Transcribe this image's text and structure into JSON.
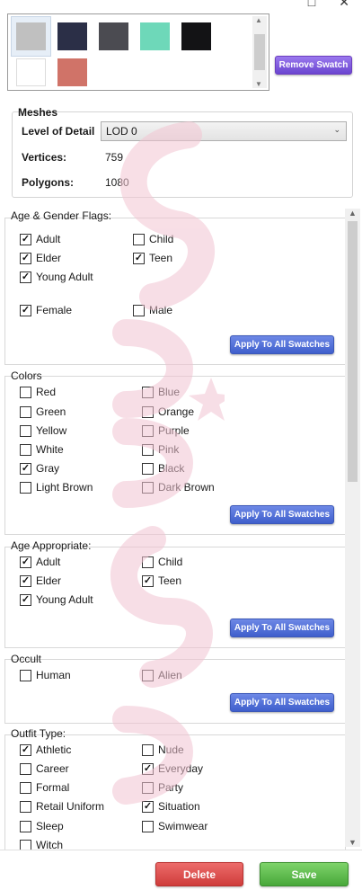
{
  "colors": {
    "swatches": [
      "#c0c0c0",
      "#2b2f47",
      "#4b4b51",
      "#6ed8b9",
      "#131315",
      "#ffffff",
      "#d07368"
    ],
    "blue_button": "#4a68d4",
    "purple_button": "#7c58dc",
    "delete": "#dc4c4a",
    "save": "#5cba4a",
    "watermark": "#f2c4d2"
  },
  "buttons": {
    "remove_swatch": "Remove Swatch",
    "apply_all": "Apply To All Swatches",
    "delete": "Delete",
    "save": "Save"
  },
  "meshes": {
    "title": "Meshes",
    "lod_label": "Level of Detail",
    "lod_value": "LOD 0",
    "vertices_label": "Vertices:",
    "vertices_value": "759",
    "polygons_label": "Polygons:",
    "polygons_value": "1080"
  },
  "age_gender": {
    "title": "Age & Gender Flags:",
    "items": [
      {
        "label": "Adult",
        "checked": true
      },
      {
        "label": "Child",
        "checked": false
      },
      {
        "label": "Elder",
        "checked": true
      },
      {
        "label": "Teen",
        "checked": true
      },
      {
        "label": "Young Adult",
        "checked": true
      },
      {
        "label": "Female",
        "checked": true
      },
      {
        "label": "Male",
        "checked": false
      }
    ]
  },
  "colors_section": {
    "title": "Colors",
    "items": [
      {
        "label": "Red",
        "checked": false
      },
      {
        "label": "Blue",
        "checked": false
      },
      {
        "label": "Green",
        "checked": false
      },
      {
        "label": "Orange",
        "checked": false
      },
      {
        "label": "Yellow",
        "checked": false
      },
      {
        "label": "Purple",
        "checked": false
      },
      {
        "label": "White",
        "checked": false
      },
      {
        "label": "Pink",
        "checked": false
      },
      {
        "label": "Gray",
        "checked": true
      },
      {
        "label": "Black",
        "checked": false
      },
      {
        "label": "Light Brown",
        "checked": false
      },
      {
        "label": "Dark Brown",
        "checked": false
      }
    ]
  },
  "age_appropriate": {
    "title": "Age Appropriate:",
    "items": [
      {
        "label": "Adult",
        "checked": true
      },
      {
        "label": "Child",
        "checked": false
      },
      {
        "label": "Elder",
        "checked": true
      },
      {
        "label": "Teen",
        "checked": true
      },
      {
        "label": "Young Adult",
        "checked": true
      }
    ]
  },
  "occult": {
    "title": "Occult",
    "items": [
      {
        "label": "Human",
        "checked": false
      },
      {
        "label": "Alien",
        "checked": false
      }
    ]
  },
  "outfit_type": {
    "title": "Outfit Type:",
    "items": [
      {
        "label": "Athletic",
        "checked": true
      },
      {
        "label": "Nude",
        "checked": false
      },
      {
        "label": "Career",
        "checked": false
      },
      {
        "label": "Everyday",
        "checked": true
      },
      {
        "label": "Formal",
        "checked": false
      },
      {
        "label": "Party",
        "checked": false
      },
      {
        "label": "Retail Uniform",
        "checked": false
      },
      {
        "label": "Situation",
        "checked": true
      },
      {
        "label": "Sleep",
        "checked": false
      },
      {
        "label": "Swimwear",
        "checked": false
      },
      {
        "label": "Witch",
        "checked": false
      }
    ]
  }
}
